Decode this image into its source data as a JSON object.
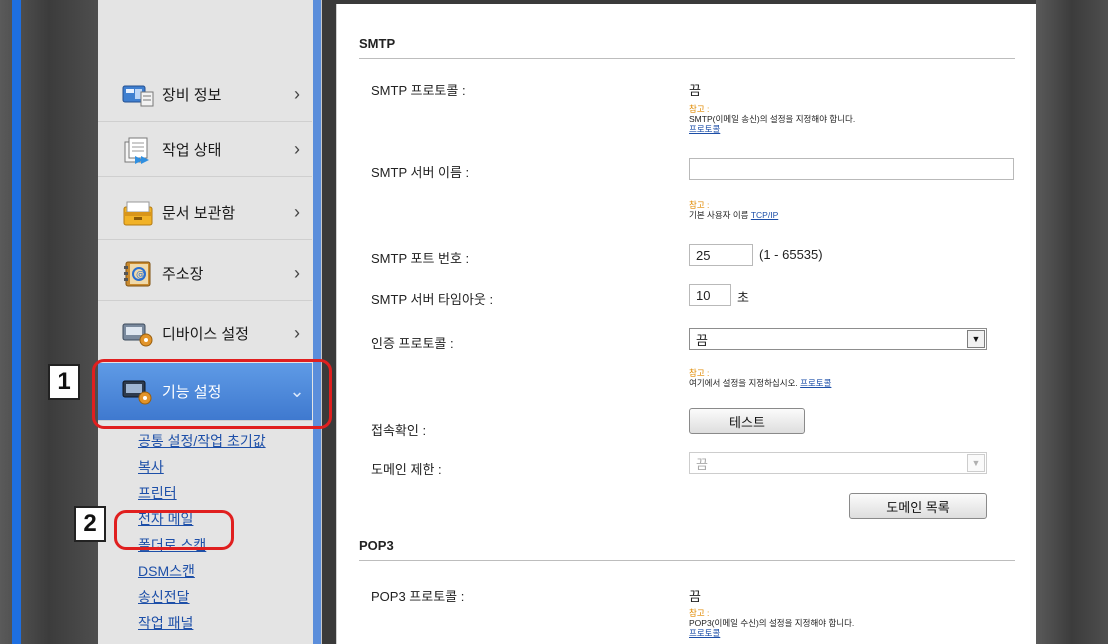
{
  "sidebar": {
    "items": [
      {
        "label": "장비 정보",
        "icon": "device-info-icon"
      },
      {
        "label": "작업 상태",
        "icon": "job-status-icon"
      },
      {
        "label": "문서 보관함",
        "icon": "document-box-icon"
      },
      {
        "label": "주소장",
        "icon": "address-book-icon"
      },
      {
        "label": "디바이스 설정",
        "icon": "device-settings-icon"
      },
      {
        "label": "기능 설정",
        "icon": "function-settings-icon"
      }
    ],
    "chevron_right": "›",
    "chevron_down": "⌄",
    "sub_links": [
      "공통 설정/작업 초기값",
      "복사",
      "프린터",
      "전자 메일",
      "폴더로 스캔",
      "DSM스캔",
      "송신전달",
      "작업 패널"
    ]
  },
  "callouts": {
    "step1": "1",
    "step2": "2"
  },
  "smtp": {
    "section_title": "SMTP",
    "protocol_label": "SMTP 프로토콜 :",
    "protocol_value": "끔",
    "protocol_note_head": "참고 :",
    "protocol_note_text": "SMTP(이메일 송신)의 설정을 지정해야 합니다.",
    "protocol_note_link": "프로토콜",
    "server_name_label": "SMTP 서버 이름 :",
    "server_name_value": "",
    "server_note_head": "참고 :",
    "server_note_text": "기본 사용자 이름",
    "server_note_link": "TCP/IP",
    "port_label": "SMTP 포트 번호 :",
    "port_value": "25",
    "port_range": "(1 - 65535)",
    "timeout_label": "SMTP 서버 타임아웃 :",
    "timeout_value": "10",
    "timeout_unit": "초",
    "auth_label": "인증 프로토콜 :",
    "auth_value": "끔",
    "auth_note_head": "참고 :",
    "auth_note_text": "여기에서 설정을 지정하십시오.",
    "auth_note_link": "프로토콜",
    "connection_label": "접속확인 :",
    "test_button": "테스트",
    "domain_label": "도메인 제한 :",
    "domain_value": "끔",
    "domain_list_button": "도메인 목록"
  },
  "pop3": {
    "section_title": "POP3",
    "protocol_label": "POP3 프로토콜 :",
    "protocol_value": "끔",
    "note_head": "참고 :",
    "note_text": "POP3(이메일 수신)의 설정을 지정해야 합니다.",
    "note_link": "프로토콜"
  }
}
